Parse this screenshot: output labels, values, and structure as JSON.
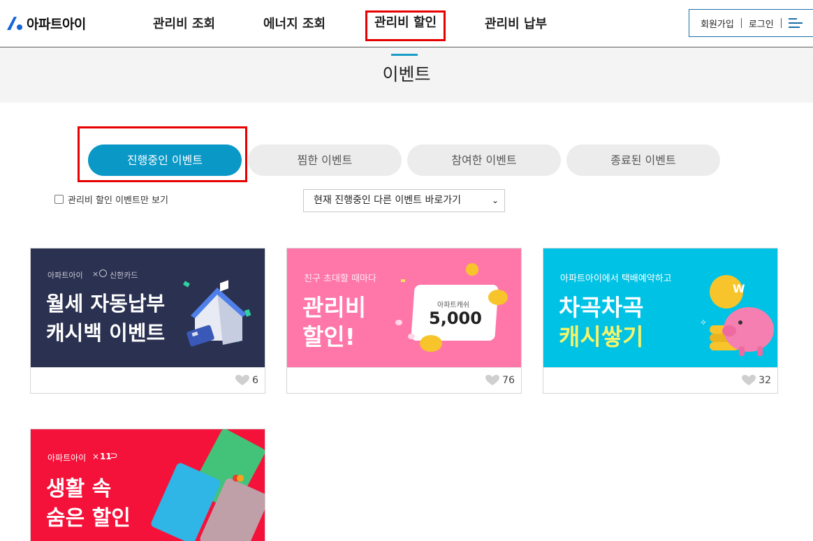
{
  "header": {
    "logo_text": "아파트아이",
    "nav": [
      "관리비 조회",
      "에너지 조회",
      "관리비 할인",
      "관리비 납부"
    ],
    "signup": "회원가입",
    "login": "로그인"
  },
  "page_title": "이벤트",
  "tabs": [
    "진행중인 이벤트",
    "찜한 이벤트",
    "참여한 이벤트",
    "종료된 이벤트"
  ],
  "filter": {
    "checkbox_label": "관리비 할인 이벤트만 보기",
    "select_value": "현재 진행중인 다른 이벤트 바로가기"
  },
  "cards": [
    {
      "brand": "아파트아이",
      "partner": "신한카드",
      "line1": "월세 자동납부",
      "line2": "캐시백 이벤트",
      "likes": "6"
    },
    {
      "top": "친구 초대할 때마다",
      "line1": "관리비",
      "line2": "할인!",
      "cash_label": "아파트캐쉬",
      "cash_value": "5,000",
      "likes": "76"
    },
    {
      "top": "아파트아이에서 택배예약하고",
      "line1": "차곡차곡",
      "line2": "캐시쌓기",
      "coin": "W",
      "likes": "32"
    },
    {
      "brand": "아파트아이",
      "partner": "11",
      "line1": "생활 속",
      "line2": "숨은 할인"
    }
  ],
  "colors": {
    "accent": "#0a98c7",
    "highlight": "#e60000",
    "card1_bg": "#2b3150",
    "card2_bg": "#ff77a8",
    "card3_bg": "#00c2e5",
    "card4_bg": "#f5123a"
  }
}
